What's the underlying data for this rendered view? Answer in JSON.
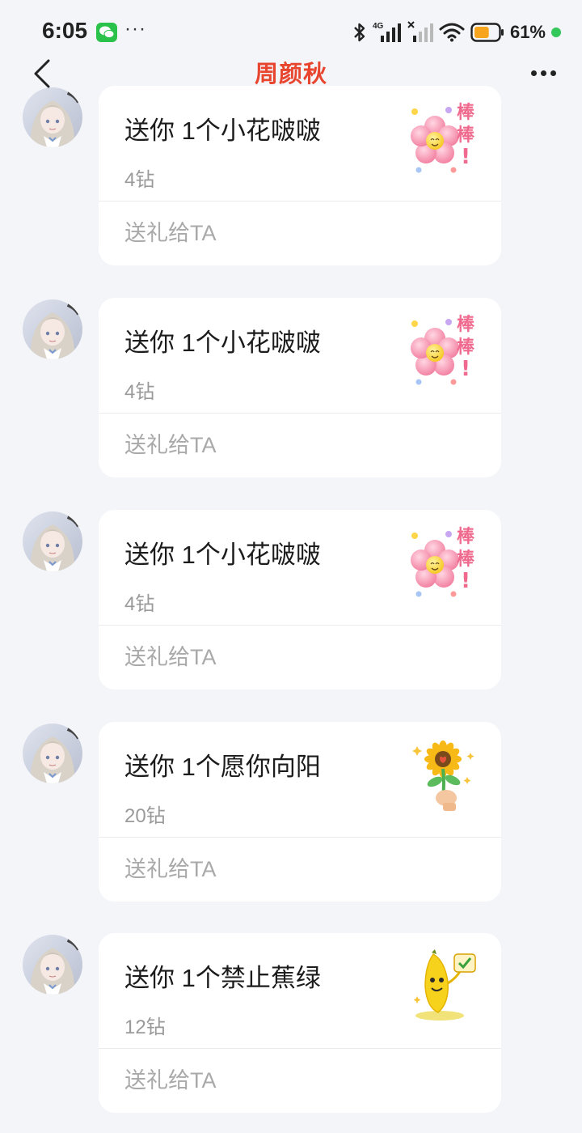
{
  "status_bar": {
    "time": "6:05",
    "dots": "···",
    "network": "4G",
    "battery_percent": "61%",
    "battery_level": 0.61,
    "icons": [
      "wechat-icon",
      "bluetooth-icon",
      "signal-icon",
      "signal-off-icon",
      "wifi-icon",
      "battery-icon"
    ]
  },
  "header": {
    "title": "周颜秋",
    "back_icon": "chevron-left-icon",
    "menu_icon": "more-horizontal-icon"
  },
  "colors": {
    "title": "#e8452f",
    "background": "#f4f5f9",
    "card": "#ffffff",
    "price_text": "#9a9a9a",
    "battery": "#f7a51c"
  },
  "messages": [
    {
      "title": "送你 1个小花啵啵",
      "price": "4钻",
      "action": "送礼给TA",
      "gift_icon": "flower-sticker-icon",
      "gift_text": "棒棒!"
    },
    {
      "title": "送你 1个小花啵啵",
      "price": "4钻",
      "action": "送礼给TA",
      "gift_icon": "flower-sticker-icon",
      "gift_text": "棒棒!"
    },
    {
      "title": "送你 1个小花啵啵",
      "price": "4钻",
      "action": "送礼给TA",
      "gift_icon": "flower-sticker-icon",
      "gift_text": "棒棒!"
    },
    {
      "title": "送你 1个愿你向阳",
      "price": "20钻",
      "action": "送礼给TA",
      "gift_icon": "sunflower-sticker-icon"
    },
    {
      "title": "送你 1个禁止蕉绿",
      "price": "12钻",
      "action": "送礼给TA",
      "gift_icon": "banana-sticker-icon"
    }
  ]
}
